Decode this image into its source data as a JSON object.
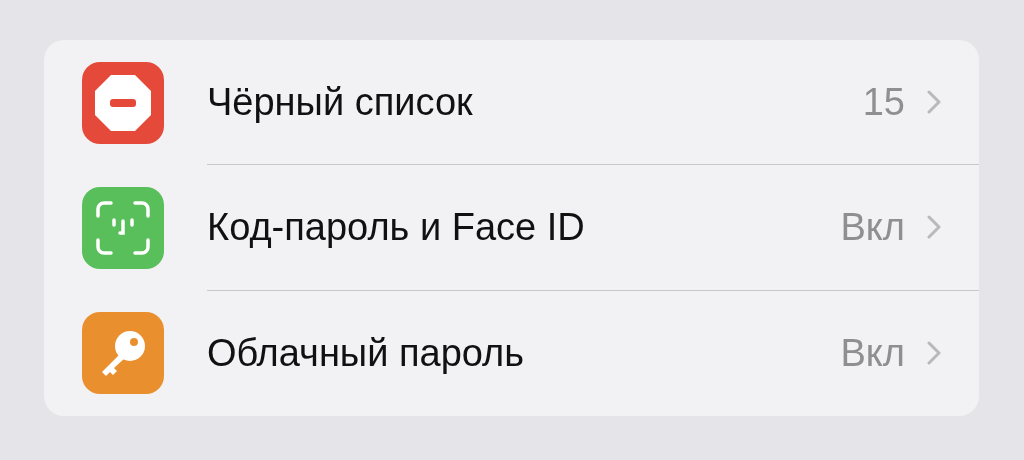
{
  "rows": [
    {
      "kind": "blocked",
      "color": "#e5493a",
      "label": "Чёрный список",
      "value": "15"
    },
    {
      "kind": "faceid",
      "color": "#58bf5b",
      "label": "Код-пароль и Face ID",
      "value": "Вкл"
    },
    {
      "kind": "key",
      "color": "#ea8f2d",
      "label": "Облачный пароль",
      "value": "Вкл"
    }
  ]
}
